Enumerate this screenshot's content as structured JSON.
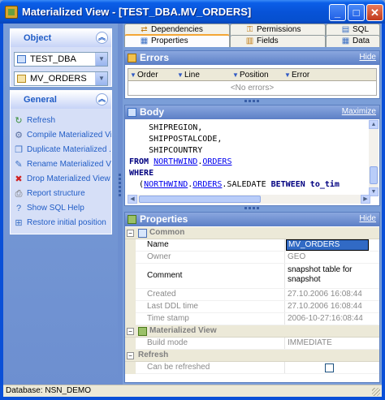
{
  "window": {
    "title": "Materialized View - [TEST_DBA.MV_ORDERS]",
    "minimize_glyph": "_",
    "maximize_glyph": "□",
    "close_glyph": "✕"
  },
  "left_pane": {
    "object_group": {
      "title": "Object",
      "collapse_glyph": "︽",
      "schema_combo": {
        "value": "TEST_DBA",
        "icon": "database-icon"
      },
      "object_combo": {
        "value": "MV_ORDERS",
        "icon": "table-icon"
      }
    },
    "general_group": {
      "title": "General",
      "collapse_glyph": "︽",
      "items": [
        {
          "label": "Refresh",
          "icon": "refresh-icon",
          "glyph": "↻",
          "color": "#3a8f3a"
        },
        {
          "label": "Compile Materialized View",
          "icon": "compile-icon",
          "glyph": "⚙",
          "color": "#5a6fa0"
        },
        {
          "label": "Duplicate Materialized ...",
          "icon": "duplicate-icon",
          "glyph": "❐",
          "color": "#3a6fc4"
        },
        {
          "label": "Rename Materialized Vie...",
          "icon": "rename-icon",
          "glyph": "✎",
          "color": "#3a6fc4"
        },
        {
          "label": "Drop Materialized View",
          "icon": "drop-icon",
          "glyph": "✖",
          "color": "#d02020"
        },
        {
          "label": "Report structure",
          "icon": "printer-icon",
          "glyph": "⎙",
          "color": "#666666"
        },
        {
          "label": "Show SQL Help",
          "icon": "help-icon",
          "glyph": "?",
          "color": "#3a6fc4"
        },
        {
          "label": "Restore initial position",
          "icon": "restore-icon",
          "glyph": "⊞",
          "color": "#3a6fc4"
        }
      ]
    }
  },
  "tabs": {
    "dependencies": "Dependencies",
    "permissions": "Permissions",
    "sql": "SQL",
    "properties": "Properties",
    "fields": "Fields",
    "data": "Data"
  },
  "errors_panel": {
    "title": "Errors",
    "link": "Hide",
    "columns": [
      "Order",
      "Line",
      "Position",
      "Error"
    ],
    "empty_text": "<No errors>"
  },
  "body_panel": {
    "title": "Body",
    "link": "Maximize",
    "lines": {
      "l1": "    SHIPREGION,",
      "l2": "    SHIPPOSTALCODE,",
      "l3": "    SHIPCOUNTRY",
      "from_kw": "FROM",
      "from_schema": "NORTHWIND",
      "dot": ".",
      "from_table": "ORDERS",
      "where_kw": "WHERE",
      "w_open": "  (",
      "w_schema": "NORTHWIND",
      "w_table": "ORDERS",
      "w_col": ".SALEDATE ",
      "w_between": "BETWEEN",
      "w_tail": " to_tim"
    }
  },
  "properties_panel": {
    "title": "Properties",
    "link": "Hide",
    "rows": [
      {
        "kind": "cat",
        "name": "Common",
        "expand": "−"
      },
      {
        "kind": "prop",
        "name": "Name",
        "value": "MV_ORDERS"
      },
      {
        "kind": "prop",
        "name": "Owner",
        "value": "GEO"
      },
      {
        "kind": "prop",
        "name": "Comment",
        "value": "snapshot table for",
        "value2": "snapshot"
      },
      {
        "kind": "prop",
        "name": "Created",
        "value": "27.10.2006 16:08:44"
      },
      {
        "kind": "prop",
        "name": "Last DDL time",
        "value": "27.10.2006 16:08:44"
      },
      {
        "kind": "prop",
        "name": "Time stamp",
        "value": "2006-10-27:16:08:44"
      },
      {
        "kind": "cat",
        "name": "Materialized View",
        "expand": "−"
      },
      {
        "kind": "prop",
        "name": "Build mode",
        "value": "IMMEDIATE"
      },
      {
        "kind": "cat",
        "name": "Refresh",
        "expand": "−"
      },
      {
        "kind": "prop",
        "name": "Can be refreshed",
        "value": ""
      }
    ]
  },
  "status_bar": {
    "text": "Database: NSN_DEMO"
  }
}
